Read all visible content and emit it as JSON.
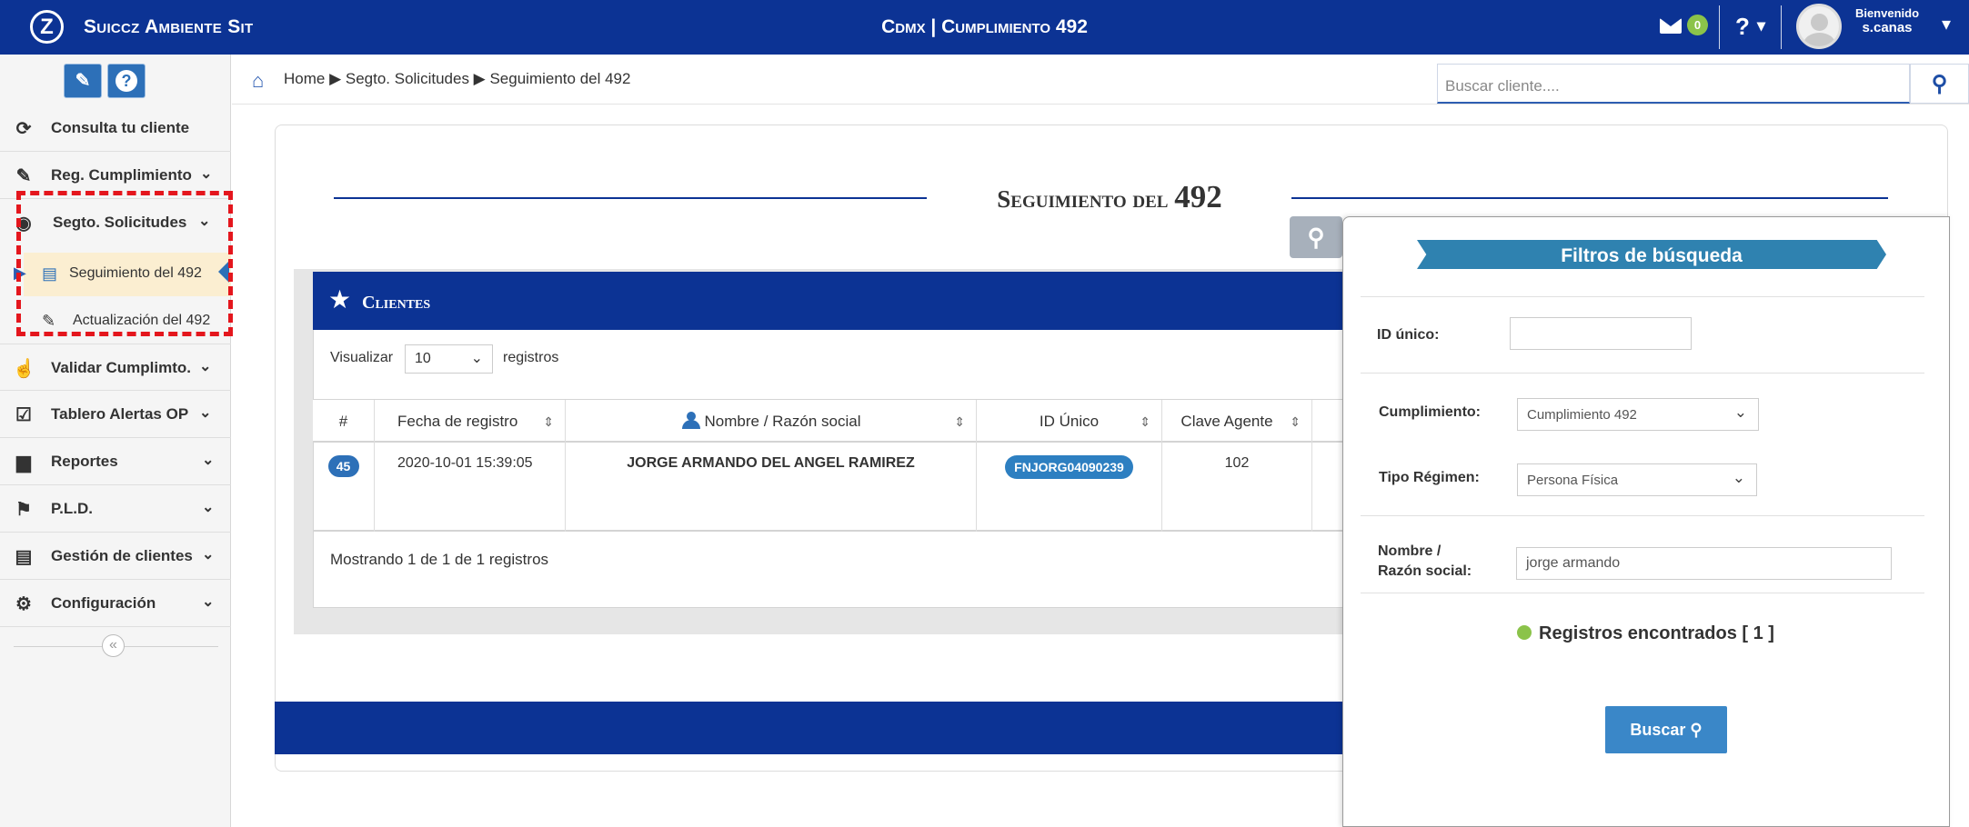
{
  "topbar": {
    "logo": "Z",
    "brand": "Suiccz Ambiente Sit",
    "title": "Cdmx | Cumplimiento 492",
    "mail_count": "0",
    "help": "?",
    "help_caret": "▾",
    "welcome": "Bienvenido",
    "user": "s.canas",
    "user_caret": "▾"
  },
  "sidebar": {
    "tools": {
      "edit": "✎",
      "help": "?"
    },
    "items": [
      {
        "label": "Consulta tu cliente",
        "icon": "refresh-icon"
      },
      {
        "label": "Reg. Cumplimiento",
        "icon": "pencil-icon"
      },
      {
        "label": "Segto. Solicitudes",
        "icon": "eye-icon"
      },
      {
        "label": "Validar Cumplimto.",
        "icon": "thumbs-up-icon"
      },
      {
        "label": "Tablero Alertas OP",
        "icon": "check-circle-icon"
      },
      {
        "label": "Reportes",
        "icon": "file-icon"
      },
      {
        "label": "P.L.D.",
        "icon": "flag-icon"
      },
      {
        "label": "Gestión de clientes",
        "icon": "list-icon"
      },
      {
        "label": "Configuración",
        "icon": "cogs-icon"
      }
    ],
    "sub_items": [
      {
        "label": "Seguimiento del 492",
        "icon": "document-icon"
      },
      {
        "label": "Actualización del 492",
        "icon": "edit-icon"
      }
    ],
    "collapse": "«"
  },
  "breadcrumb": {
    "path": "Home ▶ Segto. Solicitudes ▶ Seguimiento del 492"
  },
  "search": {
    "placeholder": "Buscar cliente...."
  },
  "page": {
    "title_text": "Seguimiento del ",
    "title_num": "492"
  },
  "clientes": {
    "heading": "Clientes",
    "show_label": "Visualizar",
    "show_value": "10",
    "show_suffix": "registros",
    "columns": [
      "#",
      "Fecha de registro",
      "Nombre / Razón social",
      "ID Único",
      "Clave Agente"
    ],
    "rows": [
      {
        "idx": "45",
        "fecha": "2020-10-01 15:39:05",
        "nombre": "JORGE ARMANDO DEL ANGEL RAMIREZ",
        "id": "FNJORG04090239",
        "clave": "102"
      }
    ],
    "footer": "Mostrando 1 de 1 de 1 registros"
  },
  "filters": {
    "title": "Filtros de búsqueda",
    "id_label": "ID único:",
    "id_value": "",
    "cumplimiento_label": "Cumplimiento:",
    "cumplimiento_value": "Cumplimiento 492",
    "regimen_label": "Tipo Régimen:",
    "regimen_value": "Persona Física",
    "nombre_label_1": "Nombre /",
    "nombre_label_2": "Razón social:",
    "nombre_value": "jorge armando",
    "found": "Registros encontrados [ 1 ]",
    "button": "Buscar"
  },
  "colors": {
    "primary": "#0c3394",
    "accent": "#2d70b8",
    "highlight": "#e4161d",
    "success": "#8bc34a"
  }
}
